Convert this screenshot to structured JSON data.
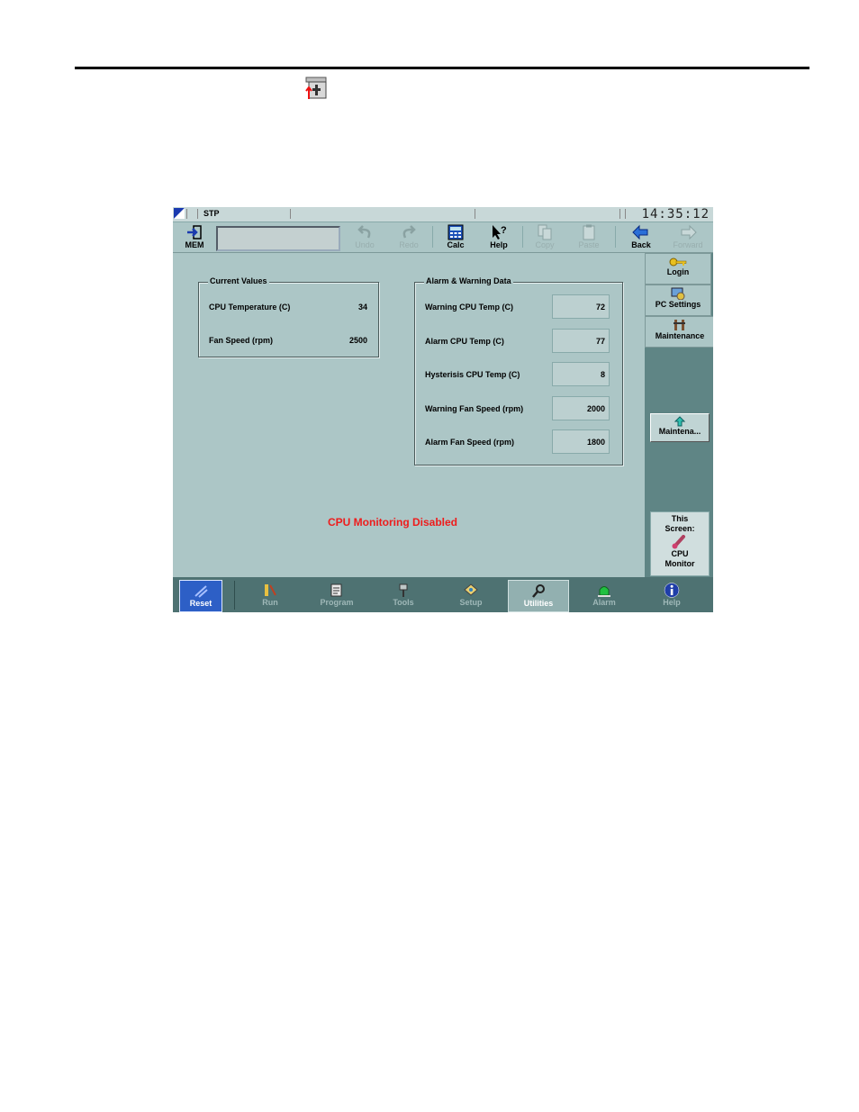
{
  "toolbar": {
    "mem_label": "MEM",
    "undo_label": "Undo",
    "redo_label": "Redo",
    "calc_label": "Calc",
    "help_label": "Help",
    "copy_label": "Copy",
    "paste_label": "Paste",
    "back_label": "Back",
    "forward_label": "Forward"
  },
  "status_bar": {
    "mode": "STP",
    "clock": "14:35:12"
  },
  "current_values": {
    "title": "Current Values",
    "rows": [
      {
        "label": "CPU Temperature (C)",
        "value": "34"
      },
      {
        "label": "Fan Speed (rpm)",
        "value": "2500"
      }
    ]
  },
  "alarm_data": {
    "title": "Alarm & Warning Data",
    "rows": [
      {
        "label": "Warning CPU Temp (C)",
        "value": "72"
      },
      {
        "label": "Alarm CPU Temp (C)",
        "value": "77"
      },
      {
        "label": "Hysterisis CPU Temp (C)",
        "value": "8"
      },
      {
        "label": "Warning Fan Speed (rpm)",
        "value": "2000"
      },
      {
        "label": "Alarm Fan Speed (rpm)",
        "value": "1800"
      }
    ]
  },
  "status_message": "CPU Monitoring Disabled",
  "right_panel": {
    "tabs": [
      "Login",
      "PC Settings",
      "Maintenance"
    ],
    "maintenance_button": "Maintena...",
    "this_screen_label": "This Screen:",
    "this_screen_line1": "This",
    "this_screen_line2": "Screen:",
    "screen_name_line1": "CPU",
    "screen_name_line2": "Monitor"
  },
  "bottom_bar": {
    "reset": "Reset",
    "run": "Run",
    "program": "Program",
    "tools": "Tools",
    "setup": "Setup",
    "utilities": "Utilities",
    "alarm": "Alarm",
    "help": "Help"
  },
  "colors": {
    "screen_bg": "#acc6c6",
    "bottom_bar": "#4e7272",
    "status_message": "#ee1c1c",
    "reset_button": "#2d5fc6"
  },
  "icons": {
    "doc_icon": "utilities-small-icon",
    "mem": "mem-arrow-icon",
    "undo": "undo-icon",
    "redo": "redo-icon",
    "calc": "calculator-icon",
    "help": "help-pointer-icon",
    "copy": "copy-icon",
    "paste": "paste-icon",
    "back": "back-arrow-icon",
    "forward": "forward-arrow-icon"
  }
}
